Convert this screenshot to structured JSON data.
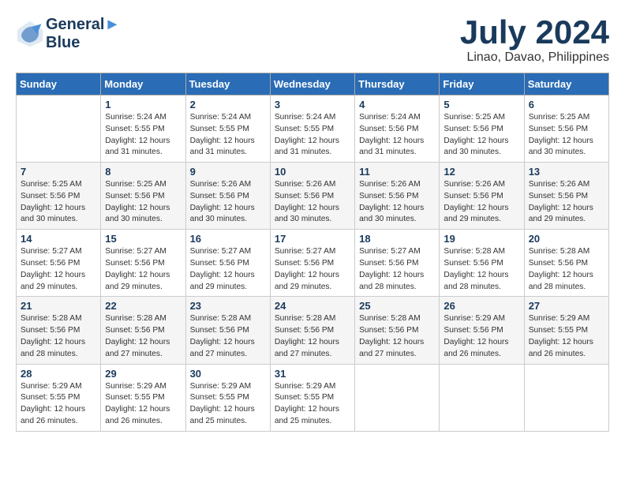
{
  "header": {
    "logo_line1": "General",
    "logo_line2": "Blue",
    "month_title": "July 2024",
    "location": "Linao, Davao, Philippines"
  },
  "days_of_week": [
    "Sunday",
    "Monday",
    "Tuesday",
    "Wednesday",
    "Thursday",
    "Friday",
    "Saturday"
  ],
  "weeks": [
    [
      {
        "day": "",
        "sunrise": "",
        "sunset": "",
        "daylight": ""
      },
      {
        "day": "1",
        "sunrise": "Sunrise: 5:24 AM",
        "sunset": "Sunset: 5:55 PM",
        "daylight": "Daylight: 12 hours and 31 minutes."
      },
      {
        "day": "2",
        "sunrise": "Sunrise: 5:24 AM",
        "sunset": "Sunset: 5:55 PM",
        "daylight": "Daylight: 12 hours and 31 minutes."
      },
      {
        "day": "3",
        "sunrise": "Sunrise: 5:24 AM",
        "sunset": "Sunset: 5:55 PM",
        "daylight": "Daylight: 12 hours and 31 minutes."
      },
      {
        "day": "4",
        "sunrise": "Sunrise: 5:24 AM",
        "sunset": "Sunset: 5:56 PM",
        "daylight": "Daylight: 12 hours and 31 minutes."
      },
      {
        "day": "5",
        "sunrise": "Sunrise: 5:25 AM",
        "sunset": "Sunset: 5:56 PM",
        "daylight": "Daylight: 12 hours and 30 minutes."
      },
      {
        "day": "6",
        "sunrise": "Sunrise: 5:25 AM",
        "sunset": "Sunset: 5:56 PM",
        "daylight": "Daylight: 12 hours and 30 minutes."
      }
    ],
    [
      {
        "day": "7",
        "sunrise": "Sunrise: 5:25 AM",
        "sunset": "Sunset: 5:56 PM",
        "daylight": "Daylight: 12 hours and 30 minutes."
      },
      {
        "day": "8",
        "sunrise": "Sunrise: 5:25 AM",
        "sunset": "Sunset: 5:56 PM",
        "daylight": "Daylight: 12 hours and 30 minutes."
      },
      {
        "day": "9",
        "sunrise": "Sunrise: 5:26 AM",
        "sunset": "Sunset: 5:56 PM",
        "daylight": "Daylight: 12 hours and 30 minutes."
      },
      {
        "day": "10",
        "sunrise": "Sunrise: 5:26 AM",
        "sunset": "Sunset: 5:56 PM",
        "daylight": "Daylight: 12 hours and 30 minutes."
      },
      {
        "day": "11",
        "sunrise": "Sunrise: 5:26 AM",
        "sunset": "Sunset: 5:56 PM",
        "daylight": "Daylight: 12 hours and 30 minutes."
      },
      {
        "day": "12",
        "sunrise": "Sunrise: 5:26 AM",
        "sunset": "Sunset: 5:56 PM",
        "daylight": "Daylight: 12 hours and 29 minutes."
      },
      {
        "day": "13",
        "sunrise": "Sunrise: 5:26 AM",
        "sunset": "Sunset: 5:56 PM",
        "daylight": "Daylight: 12 hours and 29 minutes."
      }
    ],
    [
      {
        "day": "14",
        "sunrise": "Sunrise: 5:27 AM",
        "sunset": "Sunset: 5:56 PM",
        "daylight": "Daylight: 12 hours and 29 minutes."
      },
      {
        "day": "15",
        "sunrise": "Sunrise: 5:27 AM",
        "sunset": "Sunset: 5:56 PM",
        "daylight": "Daylight: 12 hours and 29 minutes."
      },
      {
        "day": "16",
        "sunrise": "Sunrise: 5:27 AM",
        "sunset": "Sunset: 5:56 PM",
        "daylight": "Daylight: 12 hours and 29 minutes."
      },
      {
        "day": "17",
        "sunrise": "Sunrise: 5:27 AM",
        "sunset": "Sunset: 5:56 PM",
        "daylight": "Daylight: 12 hours and 29 minutes."
      },
      {
        "day": "18",
        "sunrise": "Sunrise: 5:27 AM",
        "sunset": "Sunset: 5:56 PM",
        "daylight": "Daylight: 12 hours and 28 minutes."
      },
      {
        "day": "19",
        "sunrise": "Sunrise: 5:28 AM",
        "sunset": "Sunset: 5:56 PM",
        "daylight": "Daylight: 12 hours and 28 minutes."
      },
      {
        "day": "20",
        "sunrise": "Sunrise: 5:28 AM",
        "sunset": "Sunset: 5:56 PM",
        "daylight": "Daylight: 12 hours and 28 minutes."
      }
    ],
    [
      {
        "day": "21",
        "sunrise": "Sunrise: 5:28 AM",
        "sunset": "Sunset: 5:56 PM",
        "daylight": "Daylight: 12 hours and 28 minutes."
      },
      {
        "day": "22",
        "sunrise": "Sunrise: 5:28 AM",
        "sunset": "Sunset: 5:56 PM",
        "daylight": "Daylight: 12 hours and 27 minutes."
      },
      {
        "day": "23",
        "sunrise": "Sunrise: 5:28 AM",
        "sunset": "Sunset: 5:56 PM",
        "daylight": "Daylight: 12 hours and 27 minutes."
      },
      {
        "day": "24",
        "sunrise": "Sunrise: 5:28 AM",
        "sunset": "Sunset: 5:56 PM",
        "daylight": "Daylight: 12 hours and 27 minutes."
      },
      {
        "day": "25",
        "sunrise": "Sunrise: 5:28 AM",
        "sunset": "Sunset: 5:56 PM",
        "daylight": "Daylight: 12 hours and 27 minutes."
      },
      {
        "day": "26",
        "sunrise": "Sunrise: 5:29 AM",
        "sunset": "Sunset: 5:56 PM",
        "daylight": "Daylight: 12 hours and 26 minutes."
      },
      {
        "day": "27",
        "sunrise": "Sunrise: 5:29 AM",
        "sunset": "Sunset: 5:55 PM",
        "daylight": "Daylight: 12 hours and 26 minutes."
      }
    ],
    [
      {
        "day": "28",
        "sunrise": "Sunrise: 5:29 AM",
        "sunset": "Sunset: 5:55 PM",
        "daylight": "Daylight: 12 hours and 26 minutes."
      },
      {
        "day": "29",
        "sunrise": "Sunrise: 5:29 AM",
        "sunset": "Sunset: 5:55 PM",
        "daylight": "Daylight: 12 hours and 26 minutes."
      },
      {
        "day": "30",
        "sunrise": "Sunrise: 5:29 AM",
        "sunset": "Sunset: 5:55 PM",
        "daylight": "Daylight: 12 hours and 25 minutes."
      },
      {
        "day": "31",
        "sunrise": "Sunrise: 5:29 AM",
        "sunset": "Sunset: 5:55 PM",
        "daylight": "Daylight: 12 hours and 25 minutes."
      },
      {
        "day": "",
        "sunrise": "",
        "sunset": "",
        "daylight": ""
      },
      {
        "day": "",
        "sunrise": "",
        "sunset": "",
        "daylight": ""
      },
      {
        "day": "",
        "sunrise": "",
        "sunset": "",
        "daylight": ""
      }
    ]
  ]
}
